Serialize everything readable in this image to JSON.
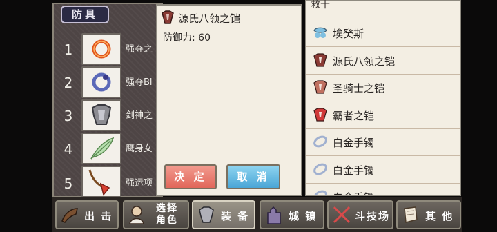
{
  "category_tab": "防具",
  "slots": [
    {
      "number": "1",
      "name": "强夺之",
      "icon": "red-ring-icon"
    },
    {
      "number": "2",
      "name": "强夺Bl",
      "icon": "blue-ring-icon"
    },
    {
      "number": "3",
      "name": "剑神之",
      "icon": "armor-icon"
    },
    {
      "number": "4",
      "name": "鹰身女",
      "icon": "feather-icon"
    },
    {
      "number": "5",
      "name": "强运项",
      "icon": "necklace-icon"
    }
  ],
  "detail": {
    "title": "源氏八领之铠",
    "defense": "防御力: 60",
    "confirm_label": "决 定",
    "cancel_label": "取 消"
  },
  "item_list": {
    "hidden_top": "救十",
    "items": [
      {
        "label": "埃癸斯",
        "icon": "shield-icon",
        "color": "#7fbfe0"
      },
      {
        "label": "源氏八领之铠",
        "icon": "armor-icon",
        "color": "#8a3a34"
      },
      {
        "label": "圣骑士之铠",
        "icon": "armor-icon",
        "color": "#c07060"
      },
      {
        "label": "霸者之铠",
        "icon": "armor-icon",
        "color": "#d03838"
      },
      {
        "label": "白金手镯",
        "icon": "bracelet-icon",
        "color": "#a0b0d0"
      },
      {
        "label": "白金手镯",
        "icon": "bracelet-icon",
        "color": "#a0b0d0"
      },
      {
        "label": "白金手镯",
        "icon": "bracelet-icon",
        "color": "#a0b0d0"
      }
    ]
  },
  "menu": {
    "sortie": "出 击",
    "select_line1": "选择",
    "select_line2": "角色",
    "equip": "装 备",
    "town": "城 镇",
    "arena": "斗技场",
    "other": "其 他"
  }
}
